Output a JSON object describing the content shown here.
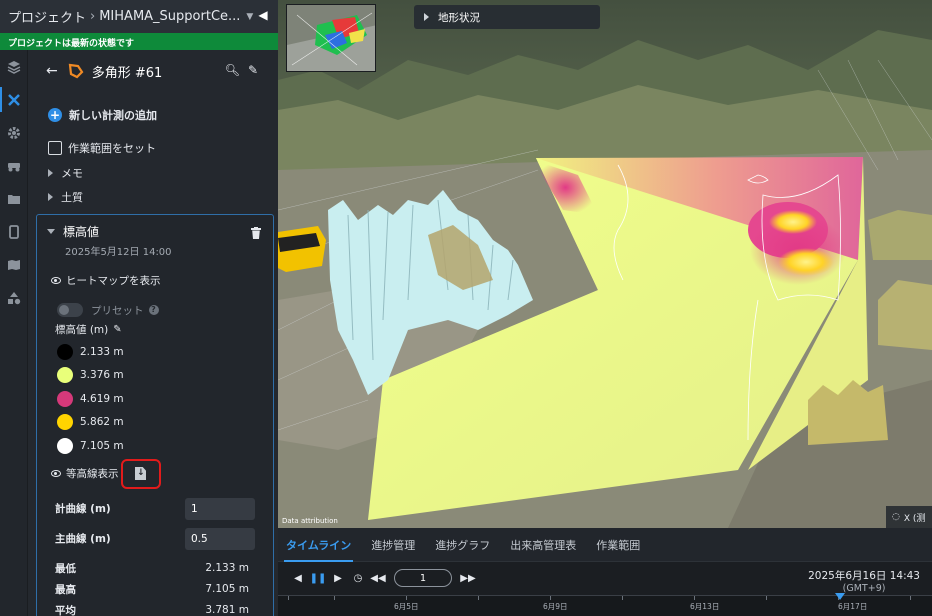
{
  "header": {
    "project_label": "プロジェクト",
    "project_name": "MIHAMA_SupportCe...",
    "status_text": "プロジェクトは最新の状態です"
  },
  "rail": {
    "items": [
      "layers-icon",
      "measure-tools-icon",
      "settings-icon",
      "vehicle-icon",
      "folder-icon",
      "mobile-icon",
      "map-icon",
      "shapes-icon"
    ]
  },
  "panel": {
    "title": "多角形 #61",
    "add_measurement": "新しい計測の追加",
    "set_work_area": "作業範囲をセット",
    "memo": "メモ",
    "soil": "土質"
  },
  "elevation": {
    "title": "標高値",
    "date": "2025年5月12日 14:00",
    "show_heatmap": "ヒートマップを表示",
    "preset": "プリセット",
    "unit_label": "標高値 (m)",
    "legend": [
      {
        "color": "#000000",
        "label": "2.133 m"
      },
      {
        "color": "#e9ff7a",
        "label": "3.376 m"
      },
      {
        "color": "#d6397a",
        "label": "4.619 m"
      },
      {
        "color": "#ffd400",
        "label": "5.862 m"
      },
      {
        "color": "#ffffff",
        "label": "7.105 m"
      }
    ],
    "show_contours": "等高線表示",
    "major_interval_label": "計曲線 (m)",
    "major_interval_value": "1",
    "minor_interval_label": "主曲線 (m)",
    "minor_interval_value": "0.5",
    "stats": [
      {
        "key": "最低",
        "value": "2.133 m"
      },
      {
        "key": "最高",
        "value": "7.105 m"
      },
      {
        "key": "平均",
        "value": "3.781 m"
      }
    ]
  },
  "map": {
    "terrain_label": "地形状況",
    "attribution": "Data attribution",
    "loading_label": "X (测"
  },
  "timeline": {
    "tabs": [
      "タイムライン",
      "進捗管理",
      "進捗グラフ",
      "出来高管理表",
      "作業範囲"
    ],
    "speed": "1",
    "datetime": "2025年6月16日 14:43",
    "timezone": "(GMT+9)",
    "axis_labels": [
      "6月5日",
      "6月9日",
      "6月13日",
      "6月17日"
    ]
  },
  "colors": {
    "accent": "#2f8fe6",
    "status_green": "#0e8a3a",
    "highlight_red": "#e21b1b"
  }
}
